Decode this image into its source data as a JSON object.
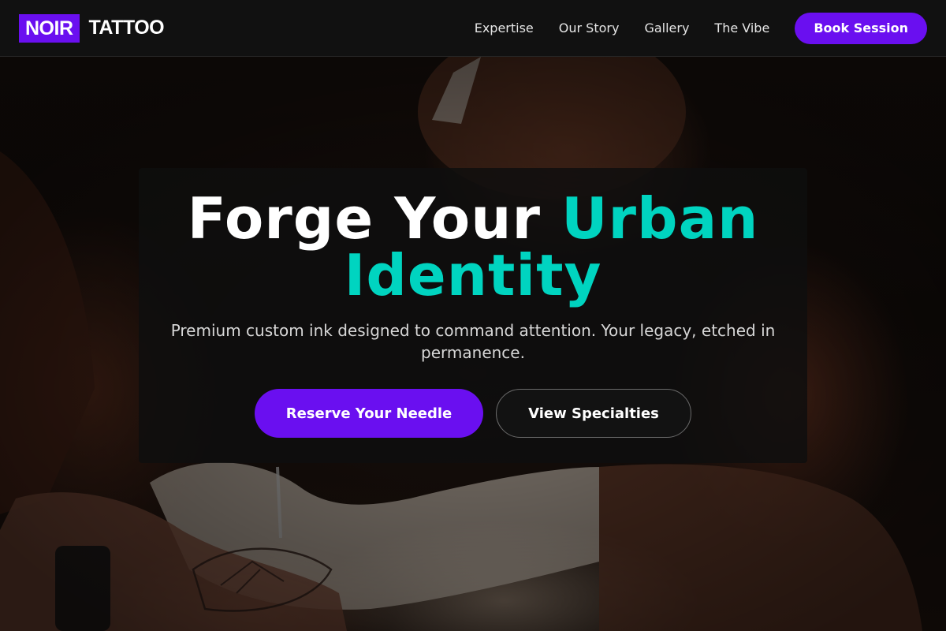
{
  "brand": {
    "logo_box_text": "NOIR",
    "logo_text": "TATTOO",
    "accent_color": "#6a0ff0",
    "highlight_color": "#00d4c0"
  },
  "nav": {
    "items": [
      {
        "label": "Expertise"
      },
      {
        "label": "Our Story"
      },
      {
        "label": "Gallery"
      },
      {
        "label": "The Vibe"
      }
    ],
    "cta_label": "Book Session"
  },
  "hero": {
    "title_part1": "Forge Your ",
    "title_accent": "Urban Identity",
    "subtitle": "Premium custom ink designed to command attention. Your legacy, etched in permanence.",
    "primary_cta": "Reserve Your Needle",
    "secondary_cta": "View Specialties",
    "background_image": "tattoo-artist-photo"
  }
}
